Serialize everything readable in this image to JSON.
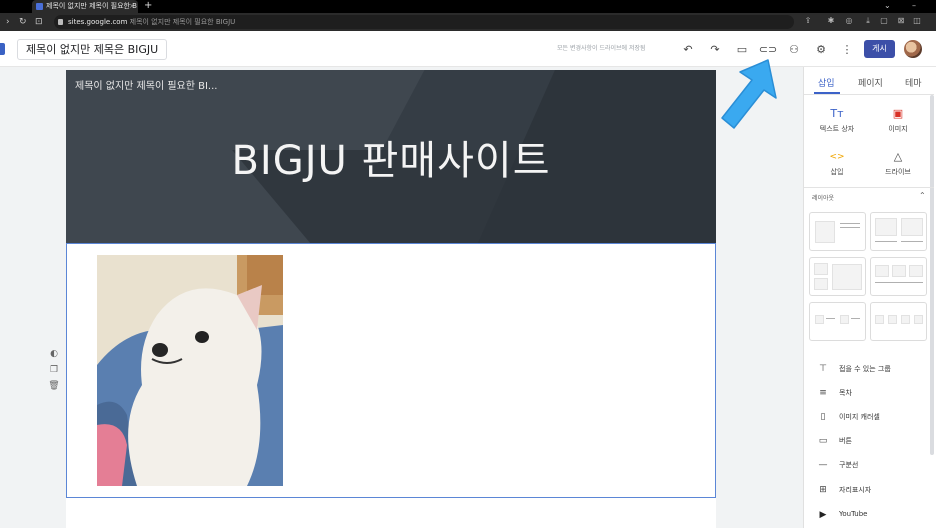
{
  "browser": {
    "tab_title": "제목이 없지만 제목이 필요한 B",
    "new_tab": "+",
    "url_host": "sites.google.com",
    "url_rest": "제목이 없지만 제목이 필요한 BIGJU"
  },
  "header": {
    "doc_title": "제목이 없지만 제목은 BIGJU",
    "save_status": "모든 변경사항이 드라이브에 저장됨",
    "publish_label": "게시"
  },
  "page": {
    "site_name": "제목이 없지만 제목이 필요한 BI...",
    "hero_title": "BIGJU 판매사이트"
  },
  "panel": {
    "tabs": [
      "삽입",
      "페이지",
      "테마"
    ],
    "insert_items": [
      {
        "icon": "Tт",
        "label": "텍스트 상자"
      },
      {
        "icon": "▣",
        "label": "이미지"
      },
      {
        "icon": "<>",
        "label": "삽입"
      },
      {
        "icon": "△",
        "label": "드라이브"
      }
    ],
    "layouts_label": "레이아웃",
    "components": [
      {
        "icon": "⊤",
        "label": "접을 수 있는 그룹"
      },
      {
        "icon": "≡",
        "label": "목차"
      },
      {
        "icon": "▯",
        "label": "이미지 캐러셀"
      },
      {
        "icon": "▭",
        "label": "버튼"
      },
      {
        "icon": "—",
        "label": "구분선"
      },
      {
        "icon": "⊞",
        "label": "자리표시자"
      },
      {
        "icon": "▶",
        "label": "YouTube"
      }
    ]
  },
  "colors": {
    "publish": "#3c4fa8",
    "accent": "#3c62c8",
    "hero_bg": "#353d45",
    "arrow": "#3aa9f0"
  }
}
